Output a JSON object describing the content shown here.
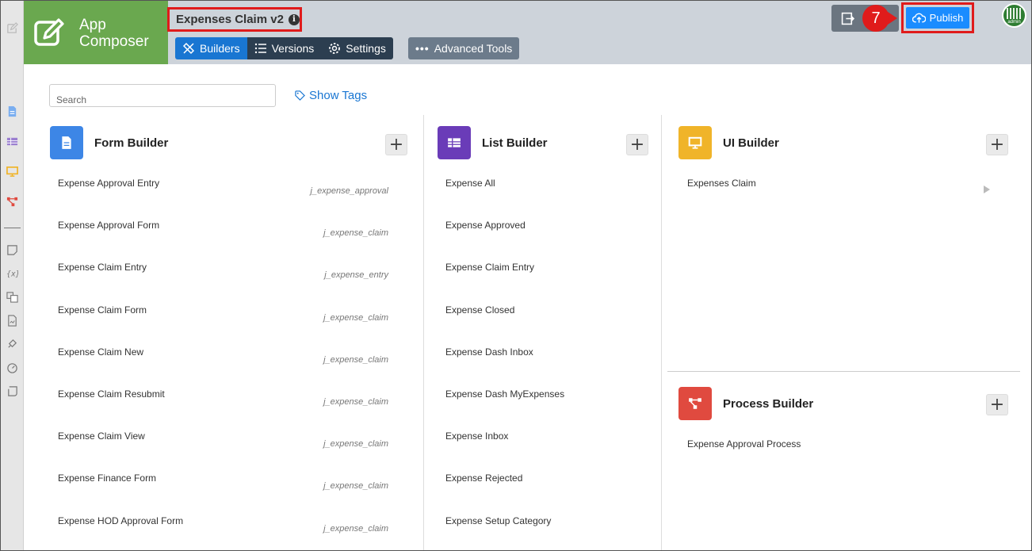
{
  "header": {
    "brand": {
      "line1": "App",
      "line2": "Composer"
    },
    "app_title": "Expenses Claim v2",
    "tabs": [
      {
        "label": "Builders",
        "icon": "builders-icon",
        "active": true
      },
      {
        "label": "Versions",
        "icon": "list-icon",
        "active": false
      },
      {
        "label": "Settings",
        "icon": "gear-icon",
        "active": false
      }
    ],
    "advanced_tools": "Advanced Tools",
    "step_badge": "7",
    "publish_label": "Publish",
    "avatar_label": "admin"
  },
  "search": {
    "placeholder": "Search"
  },
  "show_tags": "Show Tags",
  "form_builder": {
    "title": "Form Builder",
    "color": "#3d86e6",
    "items": [
      {
        "label": "Expense Approval Entry",
        "tag": "j_expense_approval"
      },
      {
        "label": "Expense Approval Form",
        "tag": "j_expense_claim"
      },
      {
        "label": "Expense Claim Entry",
        "tag": "j_expense_entry"
      },
      {
        "label": "Expense Claim Form",
        "tag": "j_expense_claim"
      },
      {
        "label": "Expense Claim New",
        "tag": "j_expense_claim"
      },
      {
        "label": "Expense Claim Resubmit",
        "tag": "j_expense_claim"
      },
      {
        "label": "Expense Claim View",
        "tag": "j_expense_claim"
      },
      {
        "label": "Expense Finance Form",
        "tag": "j_expense_claim"
      },
      {
        "label": "Expense HOD Approval Form",
        "tag": "j_expense_claim"
      }
    ]
  },
  "list_builder": {
    "title": "List Builder",
    "color": "#6a3cb8",
    "items": [
      "Expense All",
      "Expense Approved",
      "Expense Claim Entry",
      "Expense Closed",
      "Expense Dash Inbox",
      "Expense Dash MyExpenses",
      "Expense Inbox",
      "Expense Rejected",
      "Expense Setup Category"
    ]
  },
  "ui_builder": {
    "title": "UI Builder",
    "color": "#f0b429",
    "items": [
      "Expenses Claim"
    ]
  },
  "process_builder": {
    "title": "Process Builder",
    "color": "#e04a3f",
    "items": [
      "Expense Approval Process"
    ]
  },
  "colors": {
    "brand_green": "#6aa84f",
    "header_bg": "#cdd3da",
    "active_tab": "#1976d2",
    "tab_dark": "#2c3e50",
    "publish_blue": "#1a8cff",
    "highlight_red": "#e01b1b"
  }
}
